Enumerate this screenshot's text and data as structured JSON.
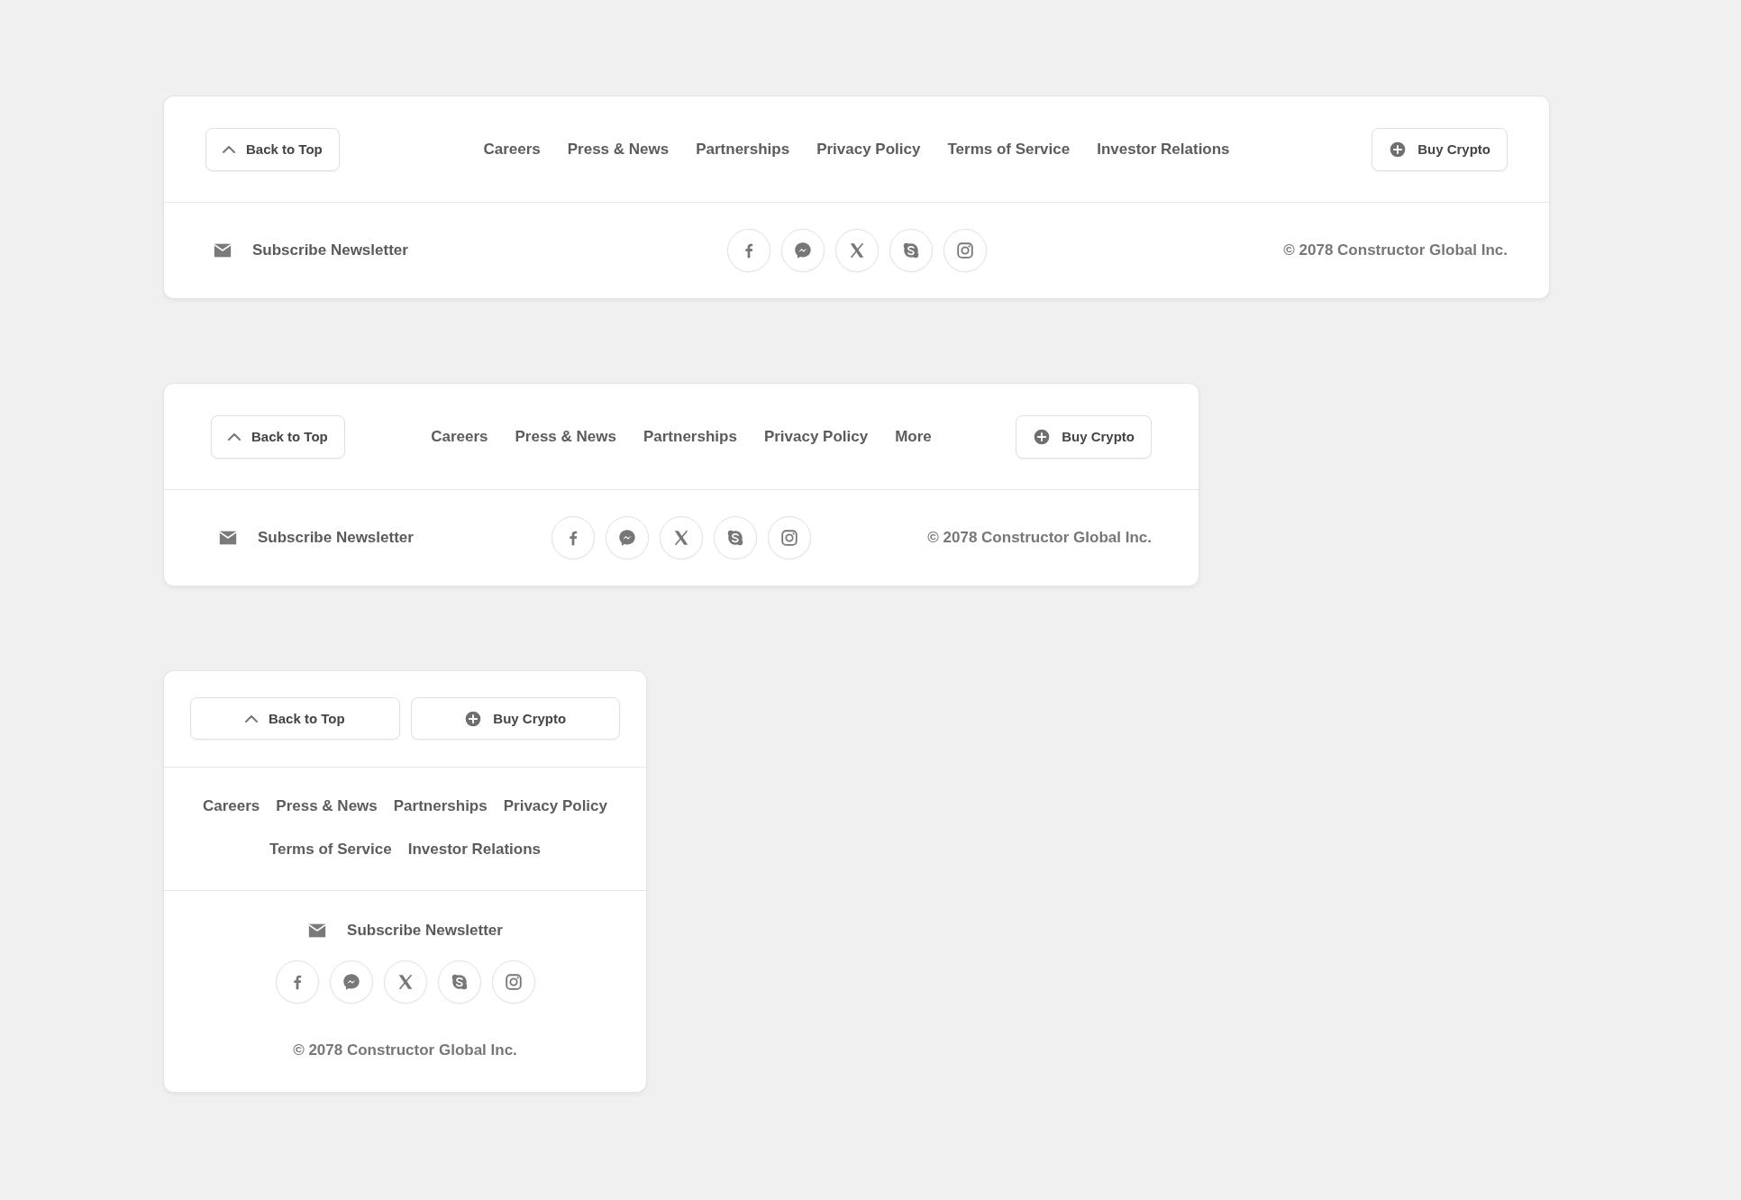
{
  "footers": [
    {
      "kind": "wide",
      "back_button": "Back to Top",
      "buy_button": "Buy Crypto",
      "links": [
        "Careers",
        "Press & News",
        "Partnerships",
        "Privacy Policy",
        "Terms of Service",
        "Investor Relations"
      ],
      "subscribe": "Subscribe Newsletter",
      "socials": [
        {
          "kind": "facebook"
        },
        {
          "kind": "messenger"
        },
        {
          "kind": "x"
        },
        {
          "kind": "skype"
        },
        {
          "kind": "instagram"
        }
      ],
      "copyright": "© 2078 Constructor Global Inc."
    },
    {
      "kind": "medium",
      "back_button": "Back to Top",
      "buy_button": "Buy Crypto",
      "links": [
        "Careers",
        "Press & News",
        "Partnerships",
        "Privacy Policy",
        "More"
      ],
      "subscribe": "Subscribe Newsletter",
      "socials": [
        {
          "kind": "facebook"
        },
        {
          "kind": "messenger"
        },
        {
          "kind": "x"
        },
        {
          "kind": "skype"
        },
        {
          "kind": "instagram"
        }
      ],
      "copyright": "© 2078 Constructor Global Inc."
    },
    {
      "kind": "compact",
      "back_button": "Back to Top",
      "buy_button": "Buy Crypto",
      "links": [
        "Careers",
        "Press & News",
        "Partnerships",
        "Privacy Policy",
        "Terms of Service",
        "Investor Relations"
      ],
      "subscribe": "Subscribe Newsletter",
      "socials": [
        {
          "kind": "facebook"
        },
        {
          "kind": "messenger"
        },
        {
          "kind": "x"
        },
        {
          "kind": "skype"
        },
        {
          "kind": "instagram"
        }
      ],
      "copyright": "© 2078 Constructor Global Inc."
    }
  ]
}
